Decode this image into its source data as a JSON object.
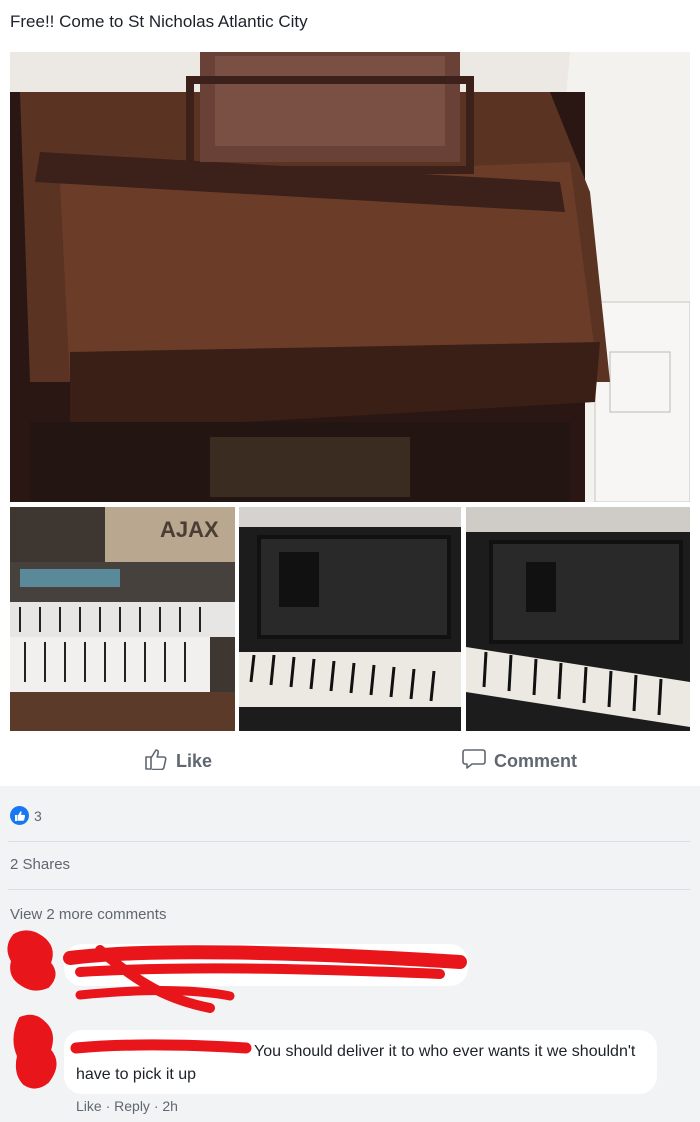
{
  "post": {
    "text": "Free!! Come to St Nicholas Atlantic City"
  },
  "actions": {
    "like_label": "Like",
    "comment_label": "Comment"
  },
  "reactions": {
    "count": "3"
  },
  "shares": "2 Shares",
  "view_more": "View 2 more comments",
  "comments": [
    {
      "text": "You should deliver it to who ever wants it we shouldn't have to pick it up",
      "like": "Like",
      "separator": "·",
      "reply": "Reply",
      "time": "2h"
    }
  ],
  "icons": {
    "like": "thumbs-up-icon",
    "comment": "speech-bubble-icon",
    "reaction": "like-reaction-icon"
  },
  "colors": {
    "brand_blue": "#1877f2",
    "redaction_red": "#e8161b"
  }
}
